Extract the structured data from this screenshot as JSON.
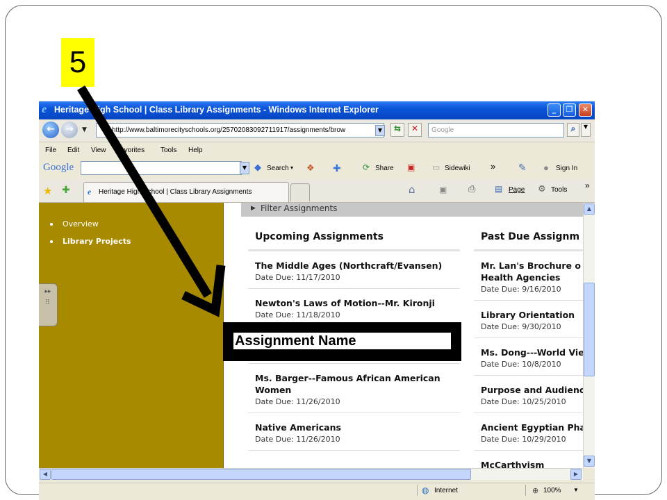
{
  "step_number": "5",
  "window": {
    "title": "Heritage High School | Class Library Assignments - Windows Internet Explorer"
  },
  "address_bar": {
    "url": "http://www.baltimorecityschools.org/25702083092711917/assignments/brow",
    "search_placeholder": "Google"
  },
  "menu": {
    "items": [
      "File",
      "Edit",
      "View",
      "Favorites",
      "Tools",
      "Help"
    ]
  },
  "google_toolbar": {
    "logo": "Google",
    "search_label": "Search",
    "share_label": "Share",
    "sidewiki_label": "Sidewiki",
    "more": "»",
    "sign_in_label": "Sign In"
  },
  "tabs": {
    "active_label": "Heritage High School | Class Library Assignments",
    "page_label": "Page",
    "tools_label": "Tools",
    "more": "»"
  },
  "sidebar": {
    "items": [
      "Overview",
      "Library Projects"
    ]
  },
  "filter": {
    "label": "Filter Assignments"
  },
  "upcoming": {
    "heading": "Upcoming Assignments",
    "items": [
      {
        "title": "The Middle Ages (Northcraft/Evansen)",
        "due": "Date Due: 11/17/2010"
      },
      {
        "title": "Newton's Laws of Motion--Mr. Kironji",
        "due": "Date Due: 11/18/2010"
      },
      {
        "title": "Ms. Barger--Famous African American Women",
        "due": "Date Due: 11/26/2010"
      },
      {
        "title": "Native Americans",
        "due": "Date Due: 11/26/2010"
      }
    ]
  },
  "past_due": {
    "heading": "Past Due Assignm",
    "items": [
      {
        "title": "Mr. Lan's Brochure o Health Agencies",
        "due": "Date Due: 9/16/2010"
      },
      {
        "title": "Library Orientation",
        "due": "Date Due: 9/30/2010"
      },
      {
        "title": "Ms. Dong---World Vie",
        "due": "Date Due: 10/8/2010"
      },
      {
        "title": "Purpose and Audienc",
        "due": "Date Due: 10/25/2010"
      },
      {
        "title": "Ancient Egyptian Pha",
        "due": "Date Due: 10/29/2010"
      },
      {
        "title": "McCarthyism",
        "due": ""
      }
    ]
  },
  "status": {
    "zone": "Internet",
    "zoom": "100%"
  },
  "callout": {
    "label": "Assignment Name"
  }
}
